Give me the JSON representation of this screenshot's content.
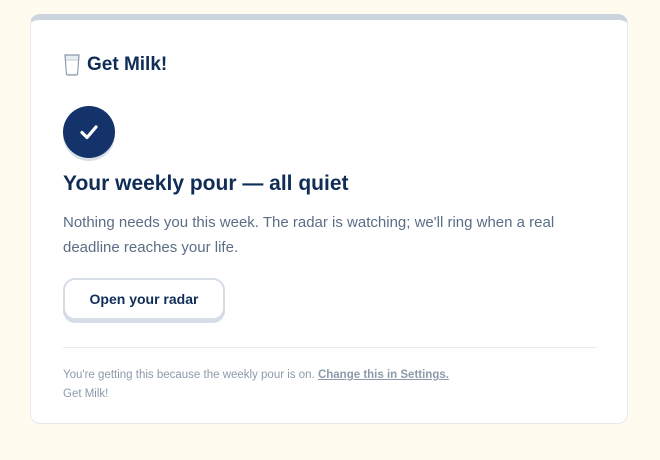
{
  "brand": {
    "icon": "milk-glass-icon",
    "name": "Get Milk!"
  },
  "status": {
    "icon": "check-icon",
    "color": "#14336b"
  },
  "headline": "Your weekly pour — all quiet",
  "body": "Nothing needs you this week. The radar is watching; we'll ring when a real deadline reaches your life.",
  "cta": {
    "label": "Open your radar"
  },
  "footer": {
    "notice": "You're getting this because the weekly pour is on.",
    "settings_link": "Change this in Settings.",
    "signature": "Get Milk!"
  },
  "colors": {
    "page_bg": "#fffcef",
    "navy": "#0f2d57",
    "muted": "#5b6e86"
  }
}
